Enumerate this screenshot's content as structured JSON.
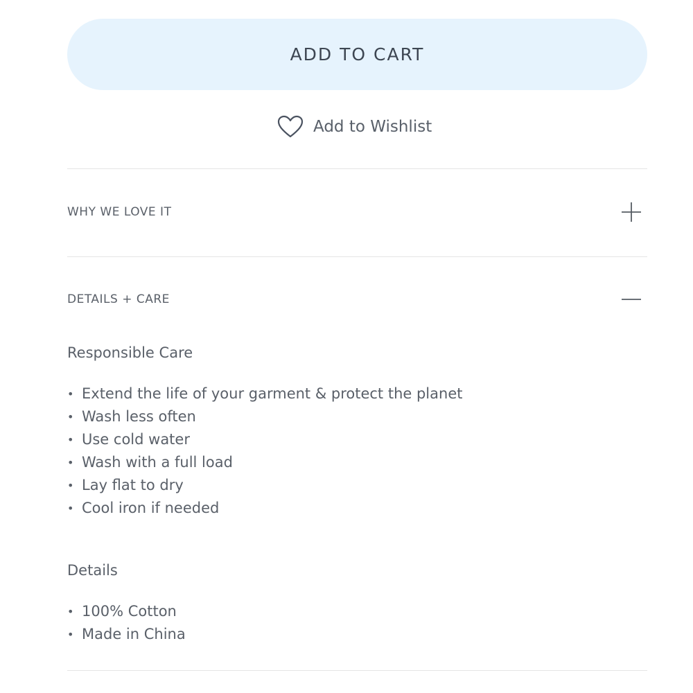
{
  "cart_button": {
    "label": "ADD TO CART",
    "background": "#e6f3fd"
  },
  "wishlist": {
    "label": "Add to Wishlist",
    "icon": "heart-outline-icon"
  },
  "accordions": [
    {
      "title": "WHY WE LOVE IT",
      "state": "collapsed",
      "icon": "plus-icon"
    },
    {
      "title": "DETAILS + CARE",
      "state": "expanded",
      "icon": "minus-icon"
    }
  ],
  "details_care": {
    "care_title": "Responsible Care",
    "care_items": [
      "Extend the life of your garment & protect the planet",
      "Wash less often",
      "Use cold water",
      "Wash with a full load",
      "Lay flat to dry",
      "Cool iron if needed"
    ],
    "details_title": "Details",
    "details_items": [
      "100% Cotton",
      "Made in China"
    ]
  }
}
